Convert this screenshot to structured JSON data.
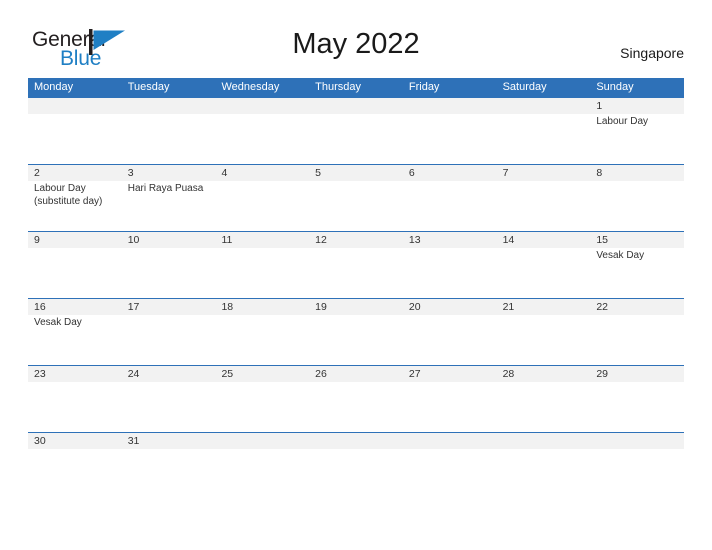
{
  "brand": {
    "word_general": "General",
    "word_blue": "Blue",
    "flag_icon": "flag-icon",
    "color_dark": "#231f20",
    "color_blue": "#1f7fc4"
  },
  "header": {
    "title": "May 2022",
    "region": "Singapore"
  },
  "theme": {
    "header_blue": "#2e71b8",
    "row_band_gray": "#f2f2f2",
    "text": "#333333",
    "page_bg": "#ffffff"
  },
  "calendar": {
    "day_names": [
      "Monday",
      "Tuesday",
      "Wednesday",
      "Thursday",
      "Friday",
      "Saturday",
      "Sunday"
    ],
    "weeks": [
      {
        "short": false,
        "days": [
          {
            "num": "",
            "event": ""
          },
          {
            "num": "",
            "event": ""
          },
          {
            "num": "",
            "event": ""
          },
          {
            "num": "",
            "event": ""
          },
          {
            "num": "",
            "event": ""
          },
          {
            "num": "",
            "event": ""
          },
          {
            "num": "1",
            "event": "Labour Day"
          }
        ]
      },
      {
        "short": false,
        "days": [
          {
            "num": "2",
            "event": "Labour Day (substitute day)"
          },
          {
            "num": "3",
            "event": "Hari Raya Puasa"
          },
          {
            "num": "4",
            "event": ""
          },
          {
            "num": "5",
            "event": ""
          },
          {
            "num": "6",
            "event": ""
          },
          {
            "num": "7",
            "event": ""
          },
          {
            "num": "8",
            "event": ""
          }
        ]
      },
      {
        "short": false,
        "days": [
          {
            "num": "9",
            "event": ""
          },
          {
            "num": "10",
            "event": ""
          },
          {
            "num": "11",
            "event": ""
          },
          {
            "num": "12",
            "event": ""
          },
          {
            "num": "13",
            "event": ""
          },
          {
            "num": "14",
            "event": ""
          },
          {
            "num": "15",
            "event": "Vesak Day"
          }
        ]
      },
      {
        "short": false,
        "days": [
          {
            "num": "16",
            "event": "Vesak Day"
          },
          {
            "num": "17",
            "event": ""
          },
          {
            "num": "18",
            "event": ""
          },
          {
            "num": "19",
            "event": ""
          },
          {
            "num": "20",
            "event": ""
          },
          {
            "num": "21",
            "event": ""
          },
          {
            "num": "22",
            "event": ""
          }
        ]
      },
      {
        "short": false,
        "days": [
          {
            "num": "23",
            "event": ""
          },
          {
            "num": "24",
            "event": ""
          },
          {
            "num": "25",
            "event": ""
          },
          {
            "num": "26",
            "event": ""
          },
          {
            "num": "27",
            "event": ""
          },
          {
            "num": "28",
            "event": ""
          },
          {
            "num": "29",
            "event": ""
          }
        ]
      },
      {
        "short": true,
        "days": [
          {
            "num": "30",
            "event": ""
          },
          {
            "num": "31",
            "event": ""
          },
          {
            "num": "",
            "event": ""
          },
          {
            "num": "",
            "event": ""
          },
          {
            "num": "",
            "event": ""
          },
          {
            "num": "",
            "event": ""
          },
          {
            "num": "",
            "event": ""
          }
        ]
      }
    ]
  }
}
